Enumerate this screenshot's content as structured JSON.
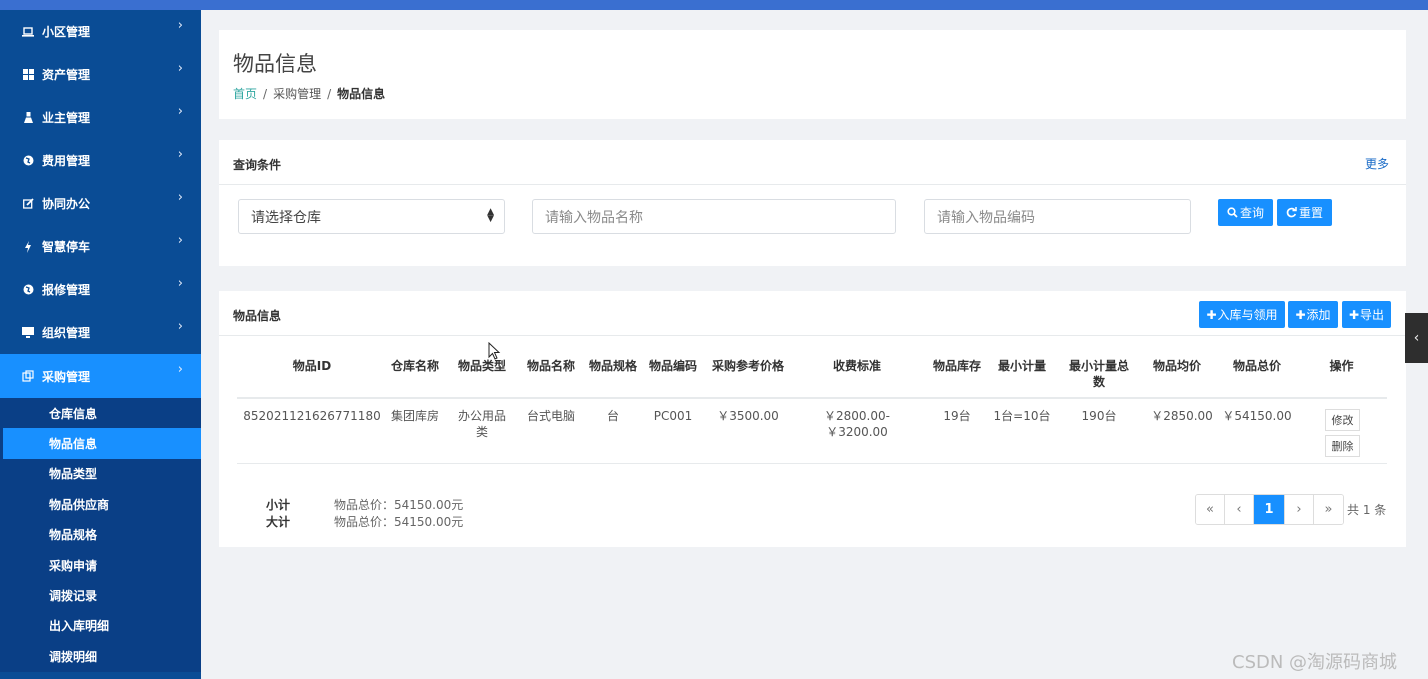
{
  "sidebar": {
    "items": [
      {
        "label": "小区管理",
        "icon": "laptop-icon"
      },
      {
        "label": "资产管理",
        "icon": "grid-icon"
      },
      {
        "label": "业主管理",
        "icon": "user-icon"
      },
      {
        "label": "费用管理",
        "icon": "globe-icon"
      },
      {
        "label": "协同办公",
        "icon": "edit-icon"
      },
      {
        "label": "智慧停车",
        "icon": "bolt-icon"
      },
      {
        "label": "报修管理",
        "icon": "globe-icon"
      },
      {
        "label": "组织管理",
        "icon": "monitor-icon"
      },
      {
        "label": "采购管理",
        "icon": "purchase-icon"
      }
    ],
    "submenu": [
      "仓库信息",
      "物品信息",
      "物品类型",
      "物品供应商",
      "物品规格",
      "采购申请",
      "调拨记录",
      "出入库明细",
      "调拨明细"
    ]
  },
  "header": {
    "title": "物品信息",
    "breadcrumb": {
      "home": "首页",
      "parent": "采购管理",
      "current": "物品信息"
    }
  },
  "search": {
    "title": "查询条件",
    "more": "更多",
    "warehouse_select": "请选择仓库",
    "name_placeholder": "请输入物品名称",
    "code_placeholder": "请输入物品编码",
    "query_label": "查询",
    "reset_label": "重置"
  },
  "list": {
    "title": "物品信息",
    "btn_in": "入库与领用",
    "btn_add": "添加",
    "btn_export": "导出",
    "columns": [
      "物品ID",
      "仓库名称",
      "物品类型",
      "物品名称",
      "物品规格",
      "物品编码",
      "采购参考价格",
      "收费标准",
      "物品库存",
      "最小计量",
      "最小计量总数",
      "物品均价",
      "物品总价",
      "操作"
    ],
    "rows": [
      {
        "id": "852021121626771180",
        "warehouse": "集团库房",
        "type": "办公用品类",
        "name": "台式电脑",
        "spec": "台",
        "code": "PC001",
        "ref_price": "￥3500.00",
        "fee": "￥2800.00-￥3200.00",
        "stock": "19台",
        "min_unit": "1台=10台",
        "min_total": "190台",
        "avg_price": "￥2850.00",
        "total_price": "￥54150.00",
        "edit": "修改",
        "delete": "删除"
      }
    ],
    "subtotal_label": "小计",
    "subtotal_value": "物品总价：54150.00元",
    "grand_label": "大计",
    "grand_value": "物品总价：54150.00元"
  },
  "pagination": {
    "first": "«",
    "prev": "‹",
    "current": "1",
    "next": "›",
    "last": "»",
    "total": "共 1 条"
  },
  "watermark": "CSDN @淘源码商城",
  "colors": {
    "sidebar": "#0a4c95",
    "accent": "#1890ff",
    "topbar": "#3a6fd0"
  }
}
